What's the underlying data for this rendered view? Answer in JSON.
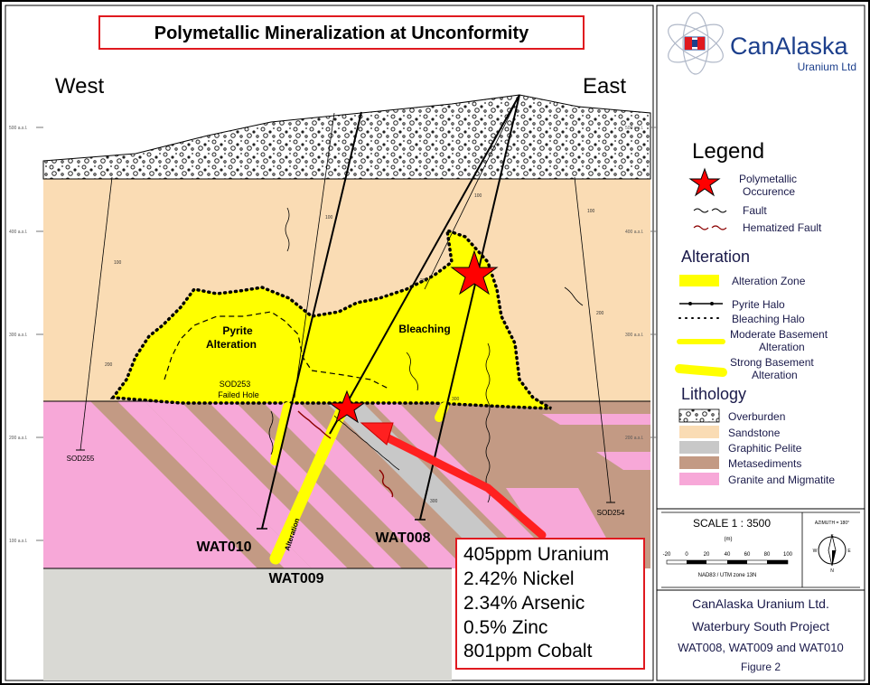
{
  "title": "Polymetallic Mineralization at Unconformity",
  "directions": {
    "west": "West",
    "east": "East"
  },
  "elevation_labels": [
    "500 a.s.l.",
    "400 a.s.l.",
    "300 a.s.l.",
    "200 a.s.l.",
    "100 a.s.l."
  ],
  "drillholes": {
    "wat010": "WAT010",
    "wat009": "WAT009",
    "wat008": "WAT008",
    "sod255": "SOD255",
    "sod254": "SOD254",
    "sod253_line1": "SOD253",
    "sod253_line2": "Failed Hole",
    "depth_100": "100",
    "depth_200": "200",
    "depth_300": "300"
  },
  "section_labels": {
    "pyrite_line1": "Pyrite",
    "pyrite_line2": "Alteration",
    "bleaching": "Bleaching",
    "alteration": "Alteration"
  },
  "assay": {
    "lines": [
      "405ppm Uranium",
      "2.42% Nickel",
      "2.34% Arsenic",
      "0.5% Zinc",
      "801ppm Cobalt"
    ],
    "border_color": "#e0191f"
  },
  "logo": {
    "name": "CanAlaska",
    "sub": "Uranium Ltd"
  },
  "legend": {
    "title": "Legend",
    "polymetallic_line1": "Polymetallic",
    "polymetallic_line2": "Occurence",
    "fault": "Fault",
    "hematized_fault": "Hematized Fault",
    "alteration_heading": "Alteration",
    "alteration_zone": "Alteration Zone",
    "pyrite_halo": "Pyrite Halo",
    "bleaching_halo": "Bleaching Halo",
    "moderate_line1": "Moderate Basement",
    "moderate_line2": "Alteration",
    "strong_line1": "Strong Basement",
    "strong_line2": "Alteration",
    "lithology_heading": "Lithology",
    "overburden": "Overburden",
    "sandstone": "Sandstone",
    "graphitic_pelite": "Graphitic Pelite",
    "metasediments": "Metasediments",
    "granite": "Granite and Migmatite"
  },
  "scale": {
    "label": "SCALE  1 : 3500",
    "unit": "(m)",
    "ticks": [
      "-20",
      "0",
      "20",
      "40",
      "60",
      "80",
      "100"
    ],
    "datum": "NAD83 / UTM zone 13N",
    "azimuth": "AZIMUTH = 180°",
    "compass": {
      "n": "N",
      "s": "S",
      "e": "E",
      "w": "W"
    }
  },
  "footer": {
    "company": "CanAlaska Uranium Ltd.",
    "project": "Waterbury South Project",
    "holes": "WAT008, WAT009 and WAT010",
    "figure": "Figure 2"
  },
  "colors": {
    "sandstone": "#fadcb4",
    "granite": "#f7a8d8",
    "metasediments": "#c39a84",
    "graphitic_pelite": "#c8c8c8",
    "alteration": "#ffff00",
    "basement_floor": "#d9d9d4",
    "star": "#ff0000",
    "title_border": "#e0191f"
  }
}
